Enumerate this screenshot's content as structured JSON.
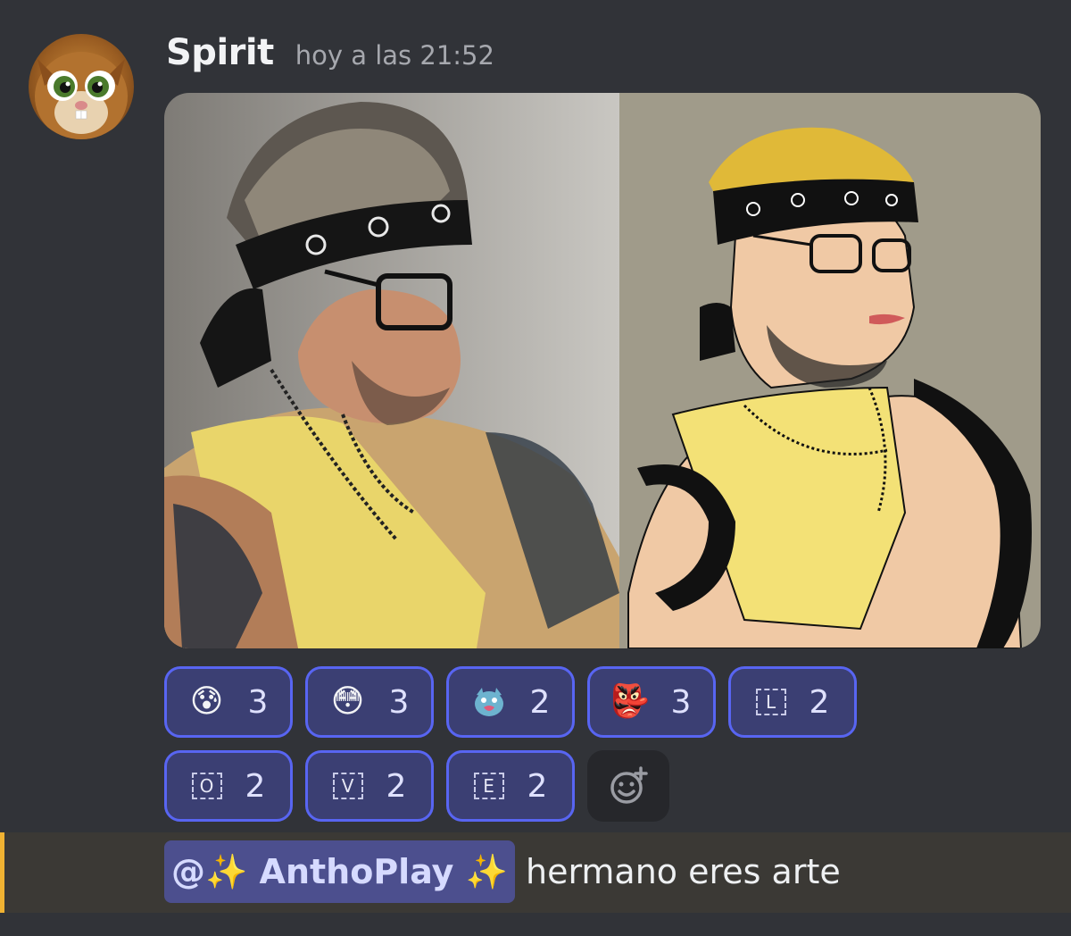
{
  "message": {
    "author": "Spirit",
    "timestamp": "hoy a las 21:52",
    "avatar_icon": "cartoon-cat-avatar",
    "attachment": {
      "left_panel": "photo",
      "right_panel": "drawing"
    }
  },
  "reactions": [
    {
      "emoji": "😰",
      "icon": "anxious-face-emoji",
      "count": "3"
    },
    {
      "emoji": "😳",
      "icon": "flushed-face-emoji",
      "count": "3"
    },
    {
      "emoji": "",
      "icon": "custom-cat-heart-emoji",
      "count": "2"
    },
    {
      "emoji": "👺",
      "icon": "goblin-mask-emoji",
      "count": "3"
    },
    {
      "emoji": "L",
      "icon": "letter-l-emoji",
      "count": "2"
    },
    {
      "emoji": "O",
      "icon": "letter-o-emoji",
      "count": "2"
    },
    {
      "emoji": "V",
      "icon": "letter-v-emoji",
      "count": "2"
    },
    {
      "emoji": "E",
      "icon": "letter-e-emoji",
      "count": "2"
    }
  ],
  "reply": {
    "mention": "@✨ AnthoPlay ✨",
    "text": "hermano eres arte"
  },
  "colors": {
    "background": "#313338",
    "reaction_border": "#5865f2",
    "reaction_bg": "#3b3f73",
    "mention_bg": "#4c4f8e",
    "highlight_bar": "#f0b232"
  }
}
